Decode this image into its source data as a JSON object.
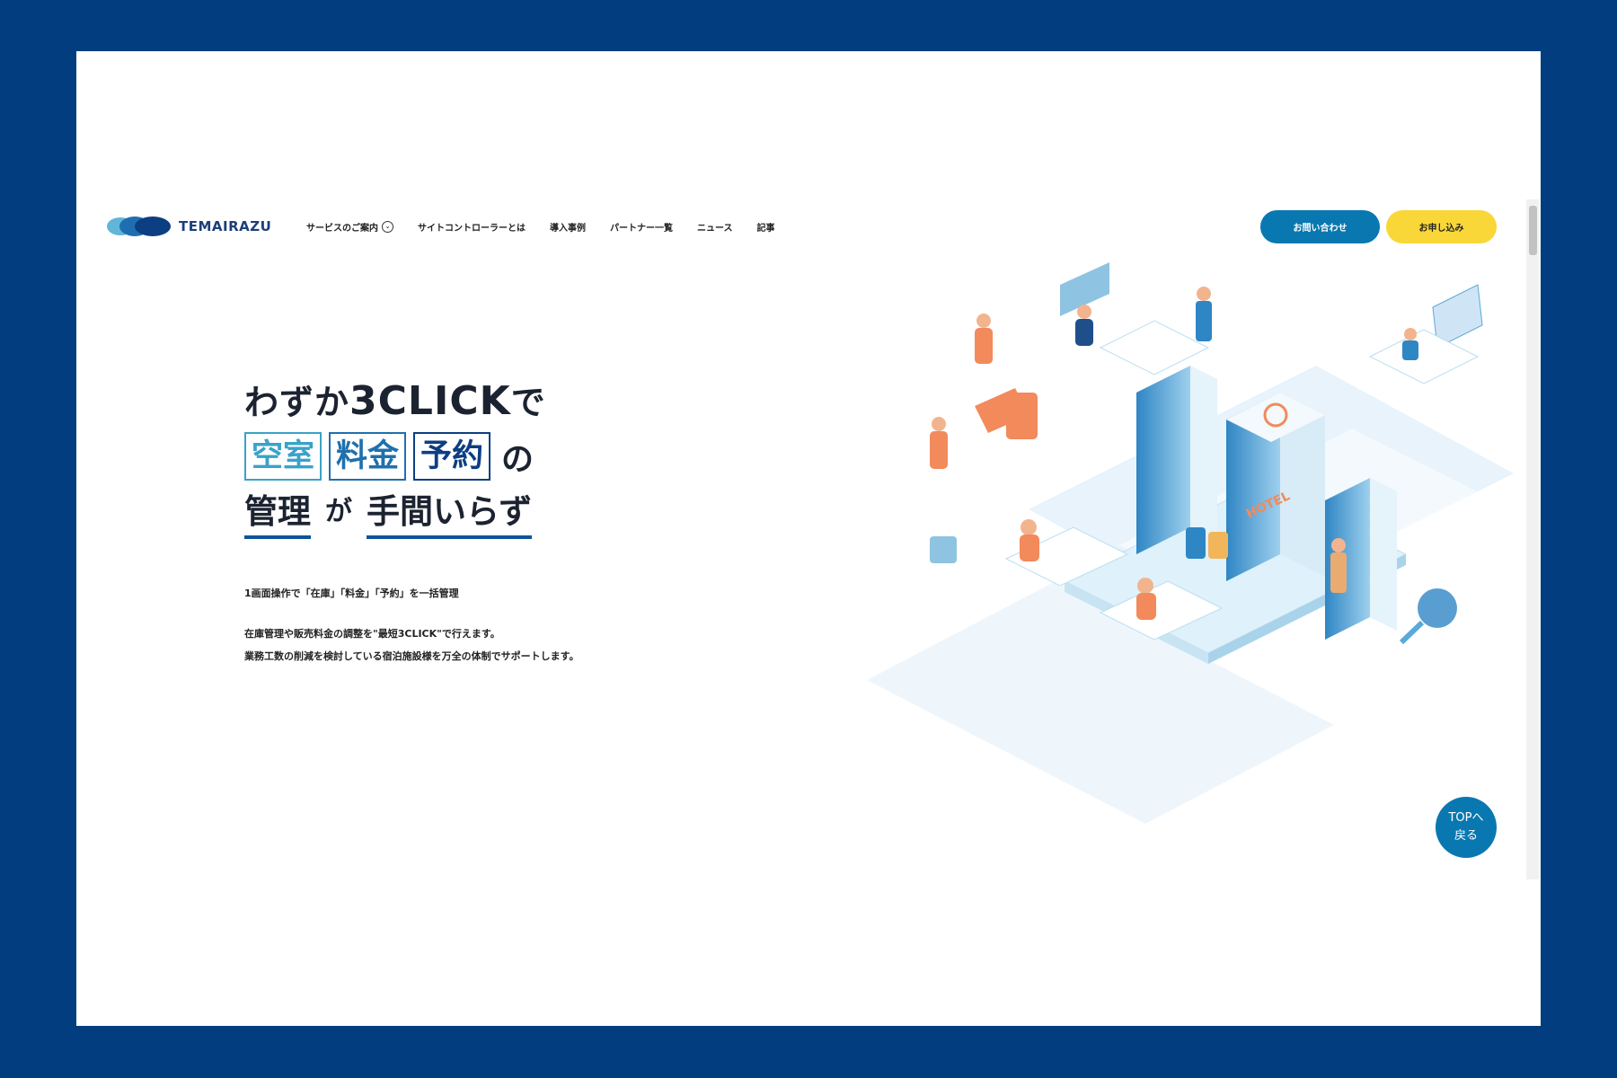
{
  "header": {
    "logo_text": "TEMAIRAZU",
    "nav": [
      {
        "label": "サービスのご案内",
        "has_dropdown": true
      },
      {
        "label": "サイトコントローラーとは"
      },
      {
        "label": "導入事例"
      },
      {
        "label": "パートナー一覧"
      },
      {
        "label": "ニュース"
      },
      {
        "label": "記事"
      }
    ],
    "contact_label": "お問い合わせ",
    "apply_label": "お申し込み"
  },
  "hero": {
    "line1_pre": "わずか",
    "line1_big": "3CLICK",
    "line1_post": "で",
    "keywords": [
      "空室",
      "料金",
      "予約"
    ],
    "line2_post": "の",
    "line3_a": "管理",
    "line3_b": "が",
    "line3_c": "手間いらず",
    "subtitle": "1画面操作で「在庫」「料金」「予約」を一括管理",
    "desc1": "在庫管理や販売料金の調整を\"最短3CLICK\"で行えます。",
    "desc2": "業務工数の削減を検討している宿泊施設様を万全の体制でサポートします。"
  },
  "totop": {
    "line1": "TOPへ",
    "line2": "戻る"
  },
  "colors": {
    "frame_bg": "#023e7f",
    "primary": "#0a78b0",
    "accent_yellow": "#f9d738"
  }
}
